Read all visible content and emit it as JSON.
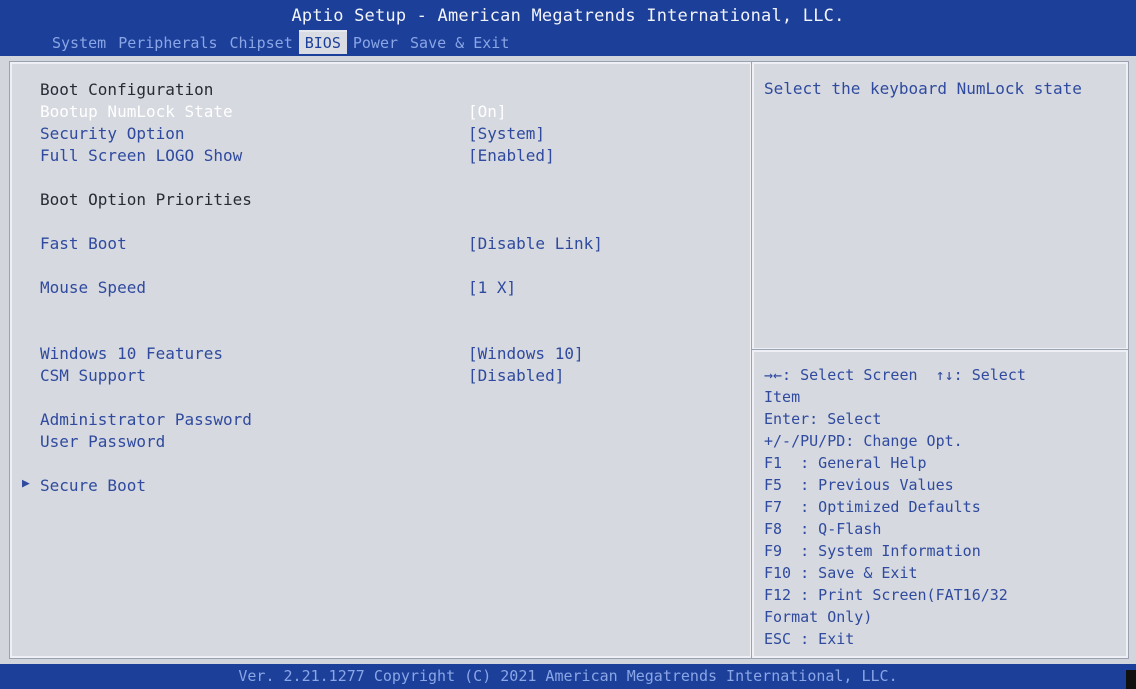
{
  "title": "Aptio Setup - American Megatrends International, LLC.",
  "tabs": [
    {
      "label": "System"
    },
    {
      "label": "Peripherals"
    },
    {
      "label": "Chipset"
    },
    {
      "label": "BIOS"
    },
    {
      "label": "Power"
    },
    {
      "label": "Save & Exit"
    }
  ],
  "active_tab": "BIOS",
  "menu": {
    "boot_configuration": "Boot Configuration",
    "bootup_numlock": {
      "label": "Bootup NumLock State",
      "value": "[On]"
    },
    "security_option": {
      "label": "Security Option",
      "value": "[System]"
    },
    "full_screen_logo": {
      "label": "Full Screen LOGO Show",
      "value": "[Enabled]"
    },
    "boot_option_priorities": "Boot Option Priorities",
    "fast_boot": {
      "label": "Fast Boot",
      "value": "[Disable Link]"
    },
    "mouse_speed": {
      "label": "Mouse Speed",
      "value": "[1 X]"
    },
    "windows_features": {
      "label": "Windows 10 Features",
      "value": "[Windows 10]"
    },
    "csm_support": {
      "label": "CSM Support",
      "value": "[Disabled]"
    },
    "admin_password": "Administrator Password",
    "user_password": "User Password",
    "secure_boot": "Secure Boot"
  },
  "help": {
    "description": "Select the keyboard NumLock state"
  },
  "keys": [
    "→←: Select Screen  ↑↓: Select",
    "Item",
    "Enter: Select",
    "+/-/PU/PD: Change Opt.",
    "F1  : General Help",
    "F5  : Previous Values",
    "F7  : Optimized Defaults",
    "F8  : Q-Flash",
    "F9  : System Information",
    "F10 : Save & Exit",
    "F12 : Print Screen(FAT16/32",
    "Format Only)",
    "ESC : Exit"
  ],
  "footer": "Ver. 2.21.1277 Copyright (C) 2021 American Megatrends International, LLC.",
  "colors": {
    "header_blue": "#1c3f99",
    "panel_gray": "#d6d9e0",
    "text_blue": "#2f4a9e",
    "text_dark": "#272b33",
    "selected_text": "#ffffff"
  }
}
